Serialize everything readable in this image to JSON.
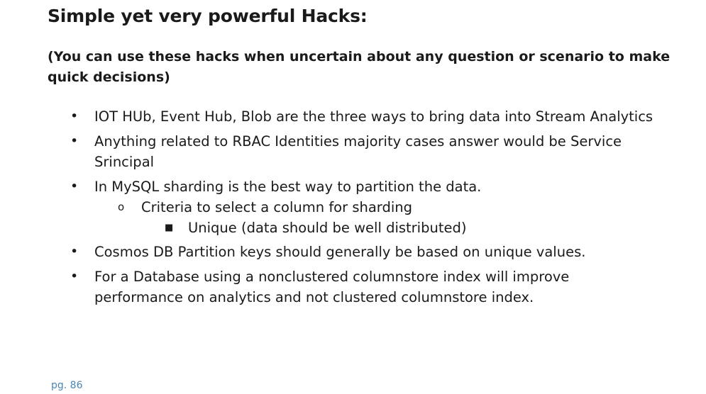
{
  "heading": "Simple yet very powerful Hacks:",
  "subheading": "(You can use these hacks when uncertain about any question or scenario to make quick decisions)",
  "bullets": {
    "b1": "IOT HUb, Event Hub, Blob are the three ways to bring data into Stream Analytics",
    "b2": "Anything related to RBAC Identities majority cases answer would be Service Srincipal",
    "b3": "In MySQL sharding is the best way to partition the data.",
    "b3_sub": "Criteria to select a column for sharding",
    "b3_subsub": "Unique (data should be well distributed)",
    "b4": "Cosmos DB Partition keys should generally be based on unique values.",
    "b5": "For a Database using a nonclustered columnstore index will improve performance on analytics and not clustered columnstore index."
  },
  "footer": "pg. 86"
}
